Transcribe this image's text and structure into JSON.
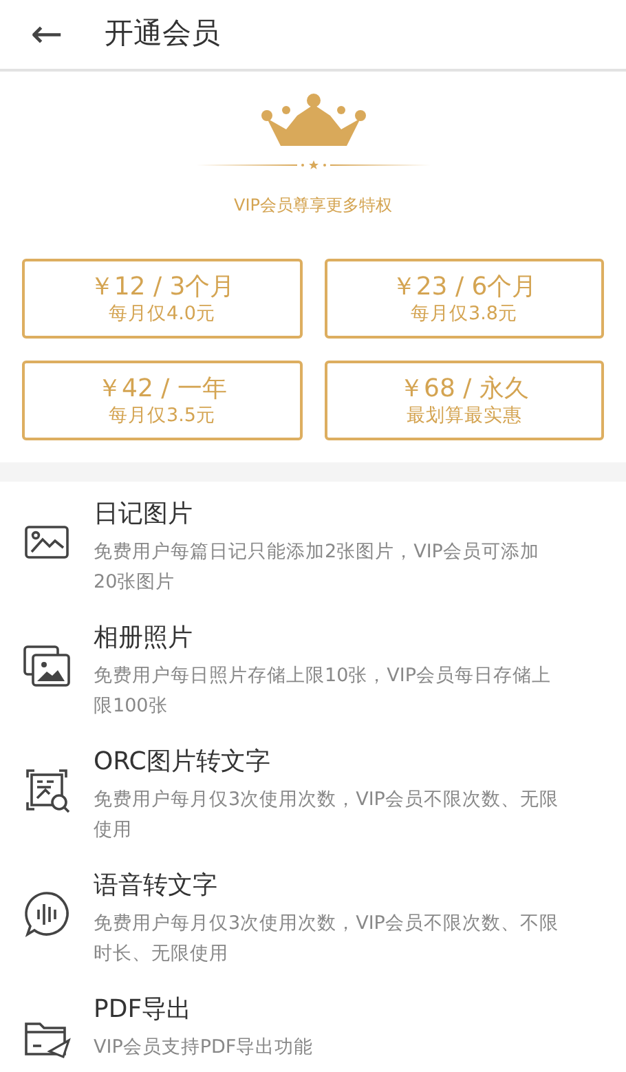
{
  "header": {
    "back_icon": "←",
    "title": "开通会员"
  },
  "banner": {
    "tagline": "VIP会员尊享更多特权"
  },
  "plans": [
    {
      "price": "￥12 / 3个月",
      "note": "每月仅4.0元"
    },
    {
      "price": "￥23 / 6个月",
      "note": "每月仅3.8元"
    },
    {
      "price": "￥42 / 一年",
      "note": "每月仅3.5元"
    },
    {
      "price": "￥68 / 永久",
      "note": "最划算最实惠"
    }
  ],
  "features": [
    {
      "kind": "image",
      "title": "日记图片",
      "description": "免费用户每篇日记只能添加2张图片，VIP会员可添加20张图片"
    },
    {
      "kind": "album",
      "title": "相册照片",
      "description": "免费用户每日照片存储上限10张，VIP会员每日存储上限100张"
    },
    {
      "kind": "scan",
      "title": "ORC图片转文字",
      "description": "免费用户每月仅3次使用次数，VIP会员不限次数、无限使用"
    },
    {
      "kind": "voice",
      "title": "语音转文字",
      "description": "免费用户每月仅3次使用次数，VIP会员不限次数、不限时长、无限使用"
    },
    {
      "kind": "export",
      "title": "PDF导出",
      "description": "VIP会员支持PDF导出功能"
    }
  ]
}
